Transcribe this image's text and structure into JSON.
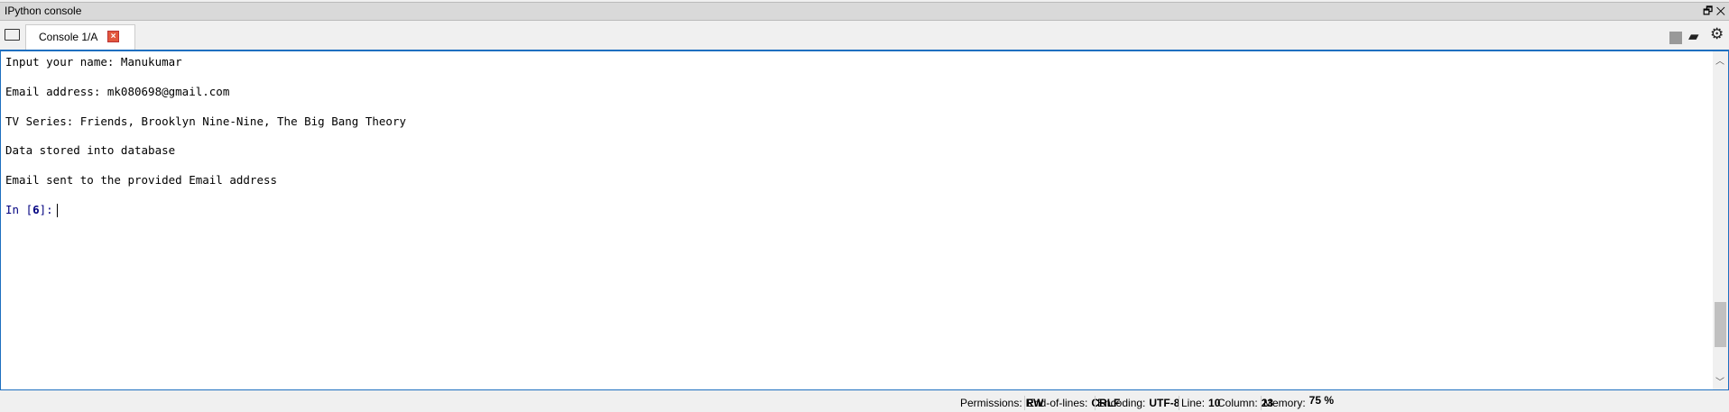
{
  "pane": {
    "title": "IPython console"
  },
  "tabs": [
    {
      "label": "Console 1/A",
      "active": true
    }
  ],
  "console": {
    "lines": [
      "Input your name: Manukumar",
      "Email address: mk080698@gmail.com",
      "TV Series: Friends, Brooklyn Nine-Nine, The Big Bang Theory",
      "Data stored into database",
      "Email sent to the provided Email address"
    ],
    "prompt_prefix": "In [",
    "prompt_number": "6",
    "prompt_suffix": "]:"
  },
  "status": {
    "permissions_label": "Permissions:",
    "permissions": "RW",
    "eol_label": "End-of-lines:",
    "eol": "CRLF",
    "encoding_label": "Encoding:",
    "encoding": "UTF-8",
    "line_label": "Line:",
    "line": "10",
    "column_label": "Column:",
    "column": "23",
    "memory_label": "Memory:",
    "memory": "75 %"
  },
  "colors": {
    "accent": "#1e6fc0",
    "tab_close": "#e2583e",
    "prompt": "#000080"
  }
}
